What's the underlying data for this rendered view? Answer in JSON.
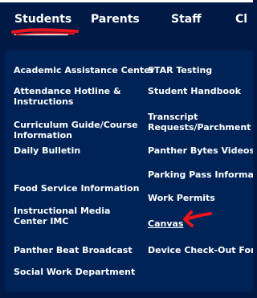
{
  "nav": {
    "tabs": [
      "Students",
      "Parents",
      "Staff",
      "Cl"
    ],
    "active": "Students"
  },
  "menu": {
    "left": [
      "Academic Assistance Center",
      "Attendance Hotline & Instructions",
      "Curriculum Guide/Course Information",
      "Daily Bulletin",
      "Food Service Information",
      "Instructional Media Center IMC",
      "Panther Beat Broadcast",
      "Social Work Department"
    ],
    "right": [
      "STAR Testing",
      "Student Handbook",
      "Transcript Requests/Parchment",
      "Panther Bytes Videos",
      "Parking Pass Informatio",
      "Work Permits",
      "Canvas",
      "Device Check-Out Form"
    ]
  },
  "colors": {
    "background": "#001a45",
    "menu_background": "#002357",
    "text": "#ffffff",
    "annotation": "#e8141c"
  }
}
